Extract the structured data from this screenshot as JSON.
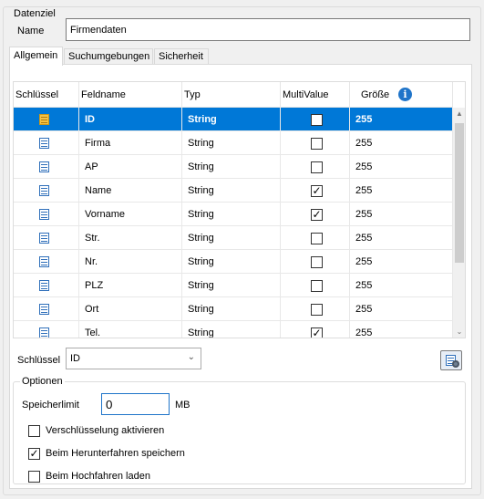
{
  "groupbox": {
    "title": "Datenziel"
  },
  "name": {
    "label": "Name",
    "value": "Firmendaten"
  },
  "tabs": [
    {
      "label": "Allgemein",
      "active": true
    },
    {
      "label": "Suchumgebungen",
      "active": false
    },
    {
      "label": "Sicherheit",
      "active": false
    }
  ],
  "grid": {
    "columns": [
      "Schlüssel",
      "Feldname",
      "Typ",
      "MultiValue",
      "Größe"
    ],
    "info_icon": "info-icon",
    "rows": [
      {
        "key_icon": "primary-key-field-icon",
        "feldname": "ID",
        "typ": "String",
        "multivalue": false,
        "groesse": "255",
        "selected": true
      },
      {
        "key_icon": "field-icon",
        "feldname": "Firma",
        "typ": "String",
        "multivalue": false,
        "groesse": "255",
        "selected": false
      },
      {
        "key_icon": "field-icon",
        "feldname": "AP",
        "typ": "String",
        "multivalue": false,
        "groesse": "255",
        "selected": false
      },
      {
        "key_icon": "field-icon",
        "feldname": "Name",
        "typ": "String",
        "multivalue": true,
        "groesse": "255",
        "selected": false
      },
      {
        "key_icon": "field-icon",
        "feldname": "Vorname",
        "typ": "String",
        "multivalue": true,
        "groesse": "255",
        "selected": false
      },
      {
        "key_icon": "field-icon",
        "feldname": "Str.",
        "typ": "String",
        "multivalue": false,
        "groesse": "255",
        "selected": false
      },
      {
        "key_icon": "field-icon",
        "feldname": "Nr.",
        "typ": "String",
        "multivalue": false,
        "groesse": "255",
        "selected": false
      },
      {
        "key_icon": "field-icon",
        "feldname": "PLZ",
        "typ": "String",
        "multivalue": false,
        "groesse": "255",
        "selected": false
      },
      {
        "key_icon": "field-icon",
        "feldname": "Ort",
        "typ": "String",
        "multivalue": false,
        "groesse": "255",
        "selected": false
      },
      {
        "key_icon": "field-icon",
        "feldname": "Tel.",
        "typ": "String",
        "multivalue": true,
        "groesse": "255",
        "selected": false
      }
    ]
  },
  "key": {
    "label": "Schlüssel",
    "value": "ID"
  },
  "options": {
    "title": "Optionen",
    "speicherlimit_label": "Speicherlimit",
    "speicherlimit_value": "0",
    "unit": "MB",
    "checkboxes": [
      {
        "label": "Verschlüsselung aktivieren",
        "checked": false
      },
      {
        "label": "Beim Herunterfahren speichern",
        "checked": true
      },
      {
        "label": "Beim Hochfahren laden",
        "checked": false
      }
    ]
  },
  "colors": {
    "selection": "#0078d7",
    "accent": "#1f74c9"
  }
}
